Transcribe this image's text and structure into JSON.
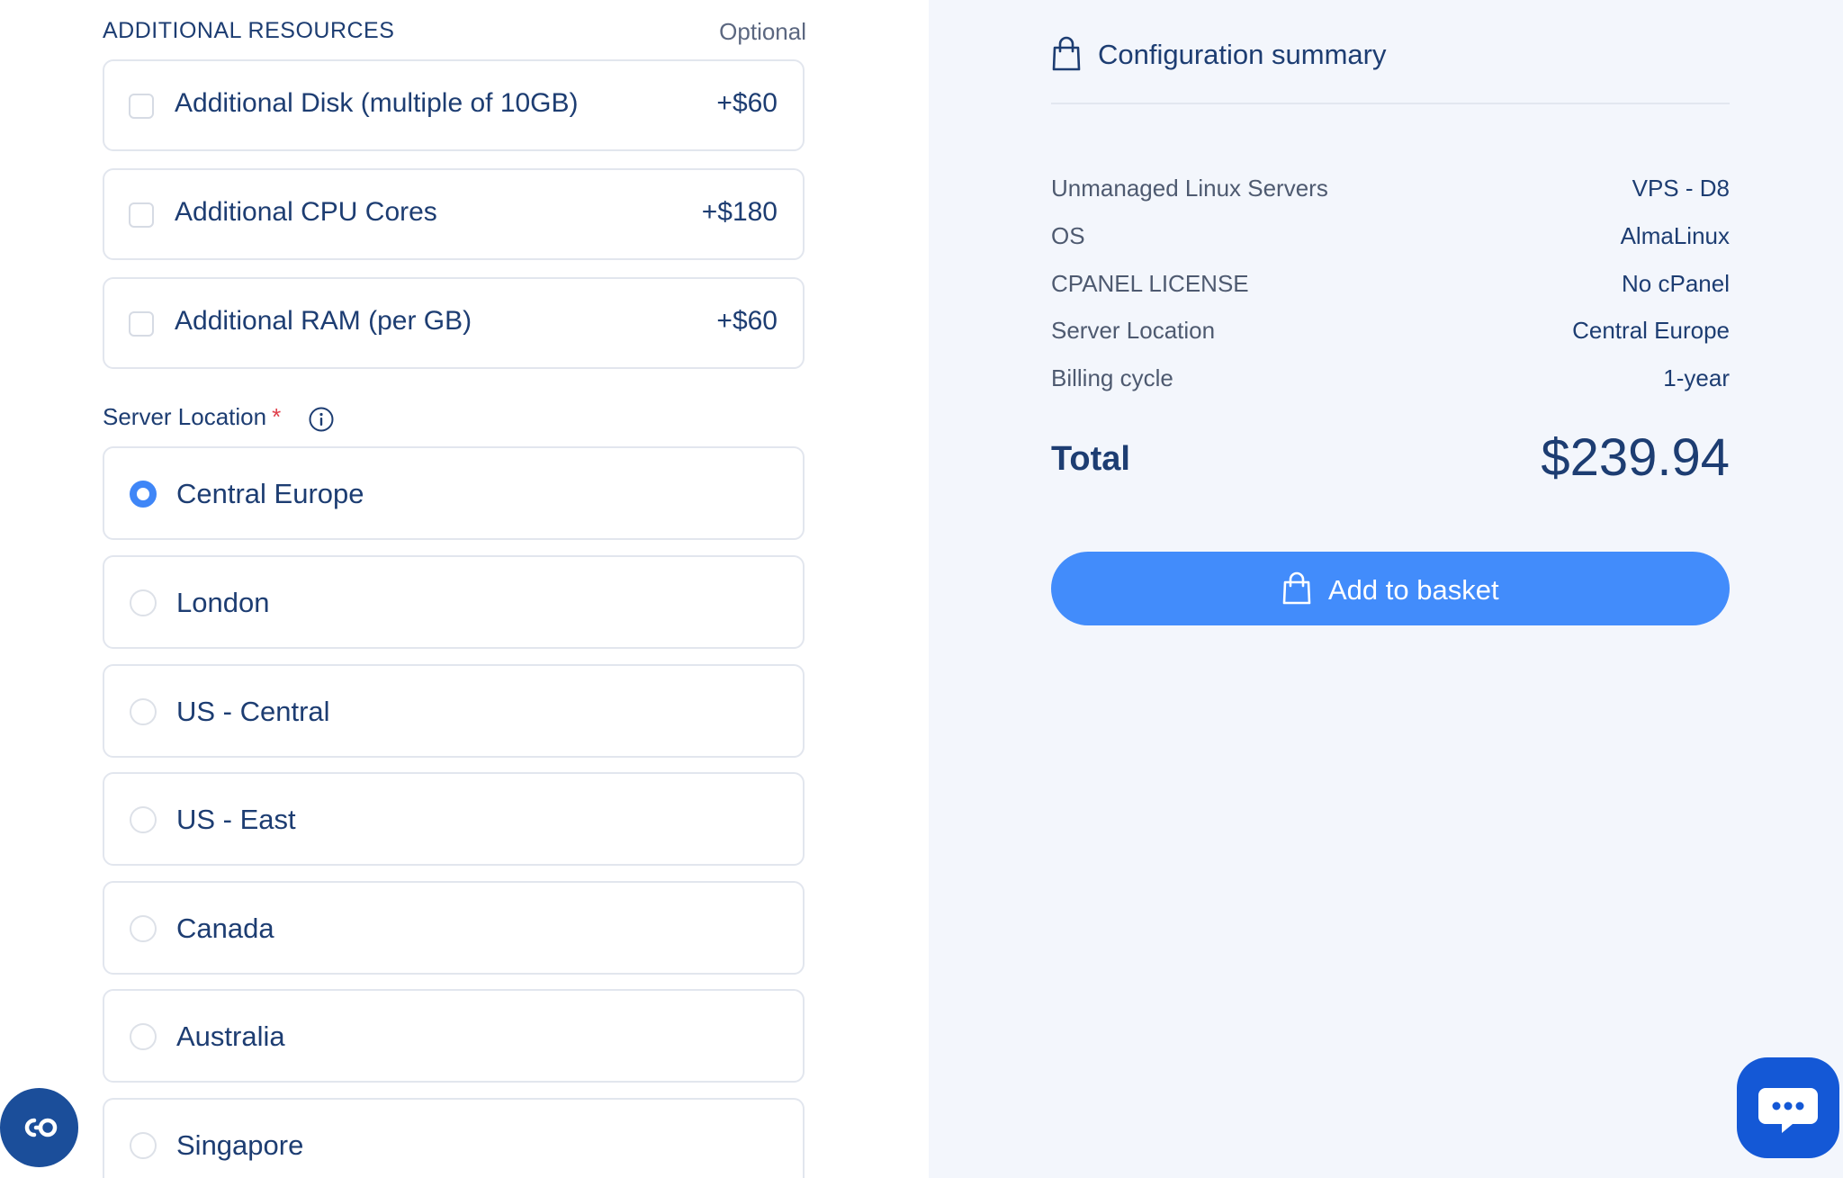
{
  "resources": {
    "title": "ADDITIONAL RESOURCES",
    "optional_label": "Optional",
    "options": [
      {
        "label": "Additional Disk (multiple of 10GB)",
        "price": "+$60",
        "checked": false
      },
      {
        "label": "Additional CPU Cores",
        "price": "+$180",
        "checked": false
      },
      {
        "label": "Additional RAM (per GB)",
        "price": "+$60",
        "checked": false
      }
    ]
  },
  "location": {
    "label": "Server Location",
    "required_mark": "*",
    "options": [
      {
        "label": "Central Europe",
        "selected": true
      },
      {
        "label": "London",
        "selected": false
      },
      {
        "label": "US - Central",
        "selected": false
      },
      {
        "label": "US - East",
        "selected": false
      },
      {
        "label": "Canada",
        "selected": false
      },
      {
        "label": "Australia",
        "selected": false
      },
      {
        "label": "Singapore",
        "selected": false
      }
    ]
  },
  "summary": {
    "title": "Configuration summary",
    "rows": [
      {
        "key": "Unmanaged Linux Servers",
        "value": "VPS - D8"
      },
      {
        "key": "OS",
        "value": "AlmaLinux"
      },
      {
        "key": "CPANEL LICENSE",
        "value": "No cPanel"
      },
      {
        "key": "Server Location",
        "value": "Central Europe"
      },
      {
        "key": "Billing cycle",
        "value": "1-year"
      }
    ],
    "total_label": "Total",
    "total_value": "$239.94",
    "add_button_label": "Add to basket"
  },
  "icons": {
    "summary": "shopping-bag-icon",
    "button": "shopping-bag-icon",
    "info": "info-icon",
    "accessibility": "accessibility-icon",
    "chat": "chat-icon"
  },
  "colors": {
    "accent": "#428cfb",
    "text": "#1d3d72",
    "required": "#e03e4a",
    "summary_bg": "#f3f6fc",
    "chat_button": "#1458d6",
    "accessibility_button": "#1b4e9a"
  }
}
